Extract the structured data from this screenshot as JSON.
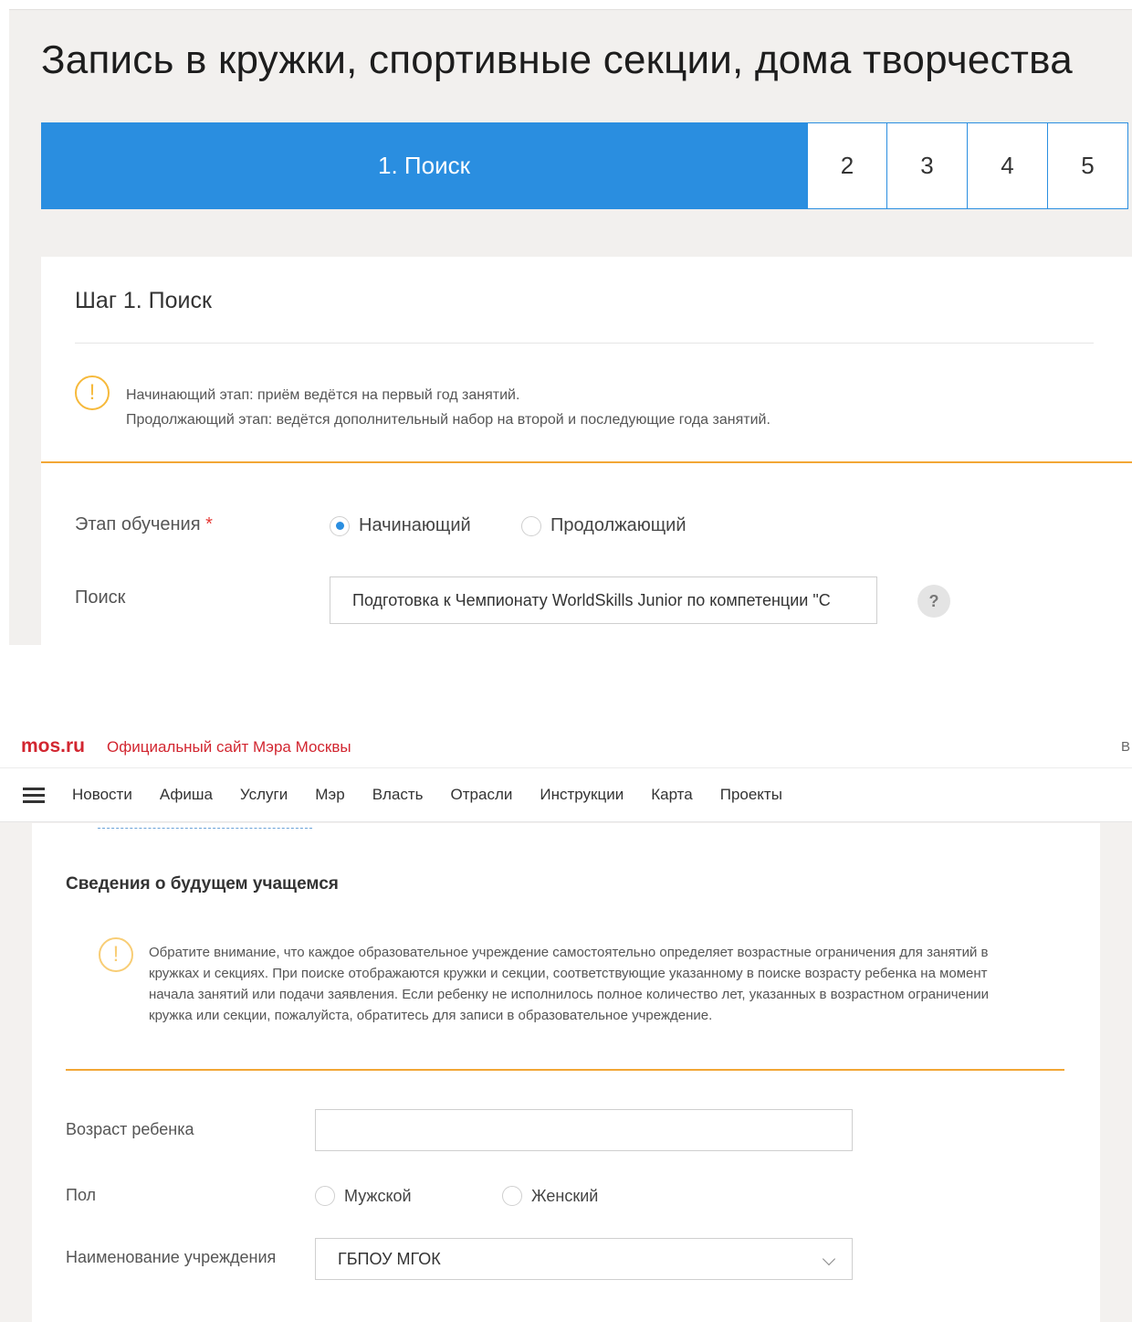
{
  "top": {
    "page_title": "Запись в кружки, спортивные секции, дома творчества",
    "steps": {
      "active_label": "1. Поиск",
      "others": [
        "2",
        "3",
        "4",
        "5"
      ]
    },
    "step_heading": "Шаг 1. Поиск",
    "notice": {
      "icon": "!",
      "line1": "Начинающий этап: приём ведётся на первый год занятий.",
      "line2": "Продолжающий этап: ведётся дополнительный набор на второй и последующие года занятий."
    },
    "stage_field": {
      "label": "Этап обучения",
      "required_mark": "*",
      "options": [
        "Начинающий",
        "Продолжающий"
      ],
      "selected": "Начинающий"
    },
    "search_field": {
      "label": "Поиск",
      "value": "Подготовка к Чемпионату WorldSkills Junior по компетенции \"С",
      "help_label": "?"
    }
  },
  "bottom": {
    "brand": {
      "logo": "mos.ru",
      "tagline": "Официальный сайт Мэра Москвы",
      "right_text": "В"
    },
    "nav": [
      "Новости",
      "Афиша",
      "Услуги",
      "Мэр",
      "Власть",
      "Отрасли",
      "Инструкции",
      "Карта",
      "Проекты"
    ],
    "section_title": "Сведения о будущем учащемся",
    "notice": {
      "icon": "!",
      "text": "Обратите внимание, что каждое образовательное учреждение самостоятельно определяет возрастные ограничения для занятий в кружках и секциях. При поиске отображаются кружки и секции, соответствующие указанному в поиске возрасту ребенка на момент начала занятий или подачи заявления. Если ребенку не исполнилось полное количество лет, указанных в возрастном ограничении кружка или секции, пожалуйста, обратитесь для записи в образовательное учреждение."
    },
    "age_field": {
      "label": "Возраст ребенка",
      "value": ""
    },
    "gender_field": {
      "label": "Пол",
      "options": [
        "Мужской",
        "Женский"
      ]
    },
    "institution_field": {
      "label": "Наименование учреждения",
      "value": "ГБПОУ МГОК"
    }
  },
  "colors": {
    "accent_blue": "#2a8ee0",
    "warning_orange": "#f6b93b",
    "divider_orange": "#f2a735",
    "brand_red": "#d22630",
    "required_red": "#e53935"
  }
}
